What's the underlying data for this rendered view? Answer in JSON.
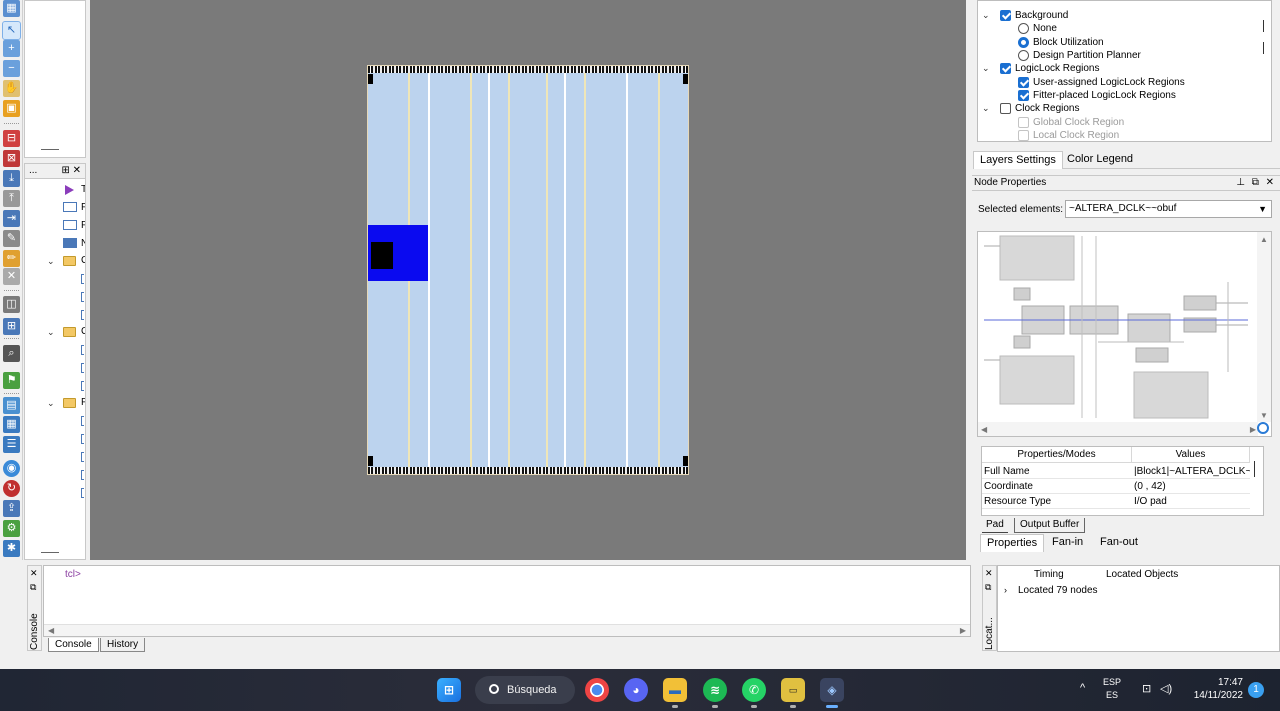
{
  "left_tree": {
    "header_dots": "...",
    "header_icons": "⊞ ✕",
    "letters": [
      "T",
      "F",
      "F",
      "N",
      "C",
      "C",
      "F"
    ]
  },
  "layers": {
    "items": [
      {
        "label": "Background",
        "kind": "checkbox",
        "checked": true,
        "level": 0,
        "expanded": true
      },
      {
        "label": "None",
        "kind": "radio",
        "checked": false,
        "level": 1
      },
      {
        "label": "Block Utilization",
        "kind": "radio",
        "checked": true,
        "level": 1
      },
      {
        "label": "Design Partition Planner",
        "kind": "radio",
        "checked": false,
        "level": 1
      },
      {
        "label": "LogicLock Regions",
        "kind": "checkbox",
        "checked": true,
        "level": 0,
        "expanded": true
      },
      {
        "label": "User-assigned LogicLock Regions",
        "kind": "checkbox",
        "checked": true,
        "level": 1
      },
      {
        "label": "Fitter-placed LogicLock Regions",
        "kind": "checkbox",
        "checked": true,
        "level": 1
      },
      {
        "label": "Clock Regions",
        "kind": "checkbox",
        "checked": false,
        "level": 0,
        "expanded": true
      },
      {
        "label": "Global Clock Region",
        "kind": "checkbox",
        "checked": false,
        "level": 1,
        "disabled": true
      },
      {
        "label": "Local Clock Region",
        "kind": "checkbox",
        "checked": false,
        "level": 1,
        "disabled": true
      }
    ],
    "tabs": [
      "Layers Settings",
      "Color Legend"
    ]
  },
  "node_properties": {
    "title": "Node Properties",
    "selected_label": "Selected elements:",
    "selected_value": "~ALTERA_DCLK~~obuf",
    "table_headers": [
      "Properties/Modes",
      "Values"
    ],
    "rows": [
      {
        "property": "Full Name",
        "value": "|Block1|~ALTERA_DCLK~"
      },
      {
        "property": "Coordinate",
        "value": "(0 , 42)"
      },
      {
        "property": "Resource Type",
        "value": "I/O pad"
      }
    ],
    "sub_tabs": [
      "Pad",
      "Output Buffer"
    ],
    "bottom_tabs": [
      "Properties",
      "Fan-in",
      "Fan-out"
    ]
  },
  "console": {
    "side_label": "Console",
    "prompt": "tcl>",
    "tabs": [
      "Console",
      "History"
    ]
  },
  "located": {
    "side_label": "Locat...",
    "headers": [
      "Timing",
      "Located Objects"
    ],
    "row": "Located 79 nodes"
  },
  "taskbar": {
    "search_label": "Búsqueda",
    "lang_top": "ESP",
    "lang_bottom": "ES",
    "time": "17:47",
    "date": "14/11/2022",
    "notifications": "1"
  },
  "colors": {
    "chip_fill": "#bcd3ee",
    "selected_block": "#0a0af0",
    "canvas_bg": "#7a7a7a",
    "accent": "#1a6fd1"
  }
}
